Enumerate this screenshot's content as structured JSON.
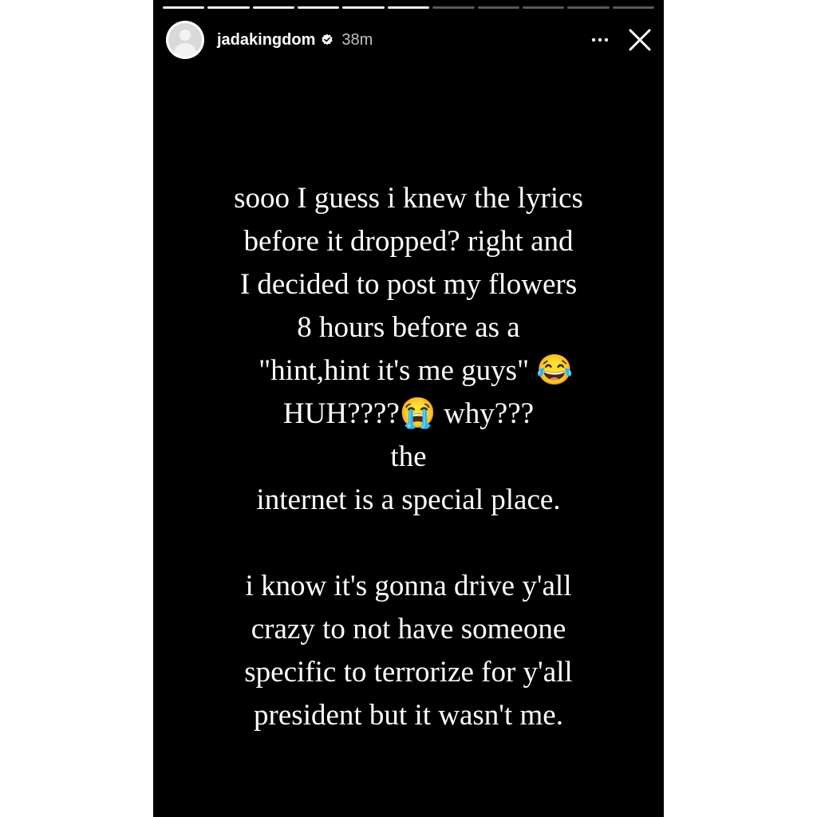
{
  "story": {
    "progress": {
      "segments_total": 11,
      "segments_viewed": 6
    },
    "header": {
      "username": "jadakingdom",
      "verified": true,
      "timestamp": "38m",
      "more_icon": "more-horizontal-icon",
      "close_icon": "close-icon"
    },
    "text_lines": [
      "sooo I guess i knew the lyrics",
      "before it dropped? right and",
      "I decided to post my flowers",
      "8 hours before as a",
      "  \"hint,hint it's me guys\" 😂",
      "HUH????😭 why???",
      "the",
      "internet is a special place.",
      "",
      "i know it's gonna drive y'all",
      "crazy to not have someone",
      "specific to terrorize for y'all",
      "president but it wasn't me."
    ],
    "colors": {
      "background": "#000000",
      "text": "#ffffff"
    }
  }
}
